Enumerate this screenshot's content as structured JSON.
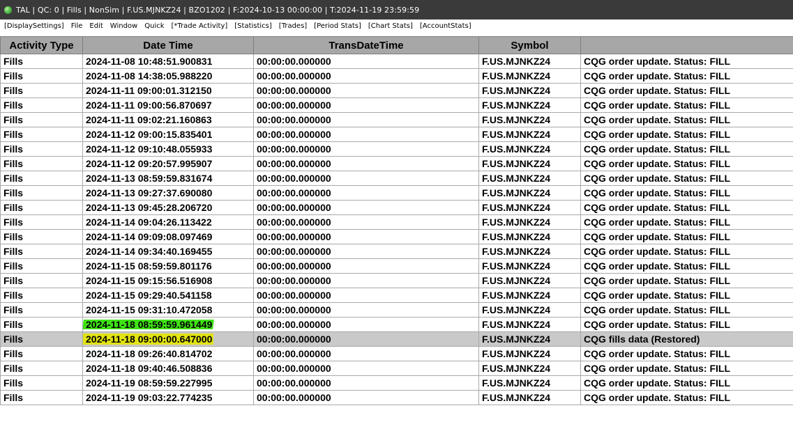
{
  "window": {
    "title": "TAL | QC: 0 | Fills | NonSim | F.US.MJNKZ24 | BZO1202 | F:2024-10-13  00:00:00 | T:2024-11-19  23:59:59"
  },
  "menu": [
    "[DisplaySettings]",
    "File",
    "Edit",
    "Window",
    "Quick",
    "[*Trade Activity]",
    "[Statistics]",
    "[Trades]",
    "[Period Stats]",
    "[Chart Stats]",
    "[AccountStats]"
  ],
  "table": {
    "columns": [
      "Activity Type",
      "Date Time",
      "TransDateTime",
      "Symbol",
      ""
    ],
    "rows": [
      {
        "activity": "Fills",
        "datetime": "2024-11-08  10:48:51.900831",
        "trans": "00:00:00.000000",
        "symbol": "F.US.MJNKZ24",
        "message": "CQG order update. Status: FILL"
      },
      {
        "activity": "Fills",
        "datetime": "2024-11-08  14:38:05.988220",
        "trans": "00:00:00.000000",
        "symbol": "F.US.MJNKZ24",
        "message": "CQG order update. Status: FILL"
      },
      {
        "activity": "Fills",
        "datetime": "2024-11-11  09:00:01.312150",
        "trans": "00:00:00.000000",
        "symbol": "F.US.MJNKZ24",
        "message": "CQG order update. Status: FILL"
      },
      {
        "activity": "Fills",
        "datetime": "2024-11-11  09:00:56.870697",
        "trans": "00:00:00.000000",
        "symbol": "F.US.MJNKZ24",
        "message": "CQG order update. Status: FILL"
      },
      {
        "activity": "Fills",
        "datetime": "2024-11-11  09:02:21.160863",
        "trans": "00:00:00.000000",
        "symbol": "F.US.MJNKZ24",
        "message": "CQG order update. Status: FILL"
      },
      {
        "activity": "Fills",
        "datetime": "2024-11-12  09:00:15.835401",
        "trans": "00:00:00.000000",
        "symbol": "F.US.MJNKZ24",
        "message": "CQG order update. Status: FILL"
      },
      {
        "activity": "Fills",
        "datetime": "2024-11-12  09:10:48.055933",
        "trans": "00:00:00.000000",
        "symbol": "F.US.MJNKZ24",
        "message": "CQG order update. Status: FILL"
      },
      {
        "activity": "Fills",
        "datetime": "2024-11-12  09:20:57.995907",
        "trans": "00:00:00.000000",
        "symbol": "F.US.MJNKZ24",
        "message": "CQG order update. Status: FILL"
      },
      {
        "activity": "Fills",
        "datetime": "2024-11-13  08:59:59.831674",
        "trans": "00:00:00.000000",
        "symbol": "F.US.MJNKZ24",
        "message": "CQG order update. Status: FILL"
      },
      {
        "activity": "Fills",
        "datetime": "2024-11-13  09:27:37.690080",
        "trans": "00:00:00.000000",
        "symbol": "F.US.MJNKZ24",
        "message": "CQG order update. Status: FILL"
      },
      {
        "activity": "Fills",
        "datetime": "2024-11-13  09:45:28.206720",
        "trans": "00:00:00.000000",
        "symbol": "F.US.MJNKZ24",
        "message": "CQG order update. Status: FILL"
      },
      {
        "activity": "Fills",
        "datetime": "2024-11-14  09:04:26.113422",
        "trans": "00:00:00.000000",
        "symbol": "F.US.MJNKZ24",
        "message": "CQG order update. Status: FILL"
      },
      {
        "activity": "Fills",
        "datetime": "2024-11-14  09:09:08.097469",
        "trans": "00:00:00.000000",
        "symbol": "F.US.MJNKZ24",
        "message": "CQG order update. Status: FILL"
      },
      {
        "activity": "Fills",
        "datetime": "2024-11-14  09:34:40.169455",
        "trans": "00:00:00.000000",
        "symbol": "F.US.MJNKZ24",
        "message": "CQG order update. Status: FILL"
      },
      {
        "activity": "Fills",
        "datetime": "2024-11-15  08:59:59.801176",
        "trans": "00:00:00.000000",
        "symbol": "F.US.MJNKZ24",
        "message": "CQG order update. Status: FILL"
      },
      {
        "activity": "Fills",
        "datetime": "2024-11-15  09:15:56.516908",
        "trans": "00:00:00.000000",
        "symbol": "F.US.MJNKZ24",
        "message": "CQG order update. Status: FILL"
      },
      {
        "activity": "Fills",
        "datetime": "2024-11-15  09:29:40.541158",
        "trans": "00:00:00.000000",
        "symbol": "F.US.MJNKZ24",
        "message": "CQG order update. Status: FILL"
      },
      {
        "activity": "Fills",
        "datetime": "2024-11-15  09:31:10.472058",
        "trans": "00:00:00.000000",
        "symbol": "F.US.MJNKZ24",
        "message": "CQG order update. Status: FILL"
      },
      {
        "activity": "Fills",
        "datetime": "2024-11-18  08:59:59.961449",
        "trans": "00:00:00.000000",
        "symbol": "F.US.MJNKZ24",
        "message": "CQG order update. Status: FILL",
        "highlight": "green"
      },
      {
        "activity": "Fills",
        "datetime": "2024-11-18  09:00:00.647000",
        "trans": "00:00:00.000000",
        "symbol": "F.US.MJNKZ24",
        "message": "CQG fills data (Restored)",
        "highlight": "yellow",
        "selected": true
      },
      {
        "activity": "Fills",
        "datetime": "2024-11-18  09:26:40.814702",
        "trans": "00:00:00.000000",
        "symbol": "F.US.MJNKZ24",
        "message": "CQG order update. Status: FILL"
      },
      {
        "activity": "Fills",
        "datetime": "2024-11-18  09:40:46.508836",
        "trans": "00:00:00.000000",
        "symbol": "F.US.MJNKZ24",
        "message": "CQG order update. Status: FILL"
      },
      {
        "activity": "Fills",
        "datetime": "2024-11-19  08:59:59.227995",
        "trans": "00:00:00.000000",
        "symbol": "F.US.MJNKZ24",
        "message": "CQG order update. Status: FILL"
      },
      {
        "activity": "Fills",
        "datetime": "2024-11-19  09:03:22.774235",
        "trans": "00:00:00.000000",
        "symbol": "F.US.MJNKZ24",
        "message": "CQG order update. Status: FILL"
      }
    ]
  },
  "colors": {
    "titlebar_bg": "#3a3a3a",
    "header_bg": "#a7a7a7",
    "selected_row_bg": "#c9c9c9",
    "highlight_green": "#3fe316",
    "highlight_yellow": "#e2e413"
  },
  "icons": {
    "app": "green-orb-icon"
  }
}
